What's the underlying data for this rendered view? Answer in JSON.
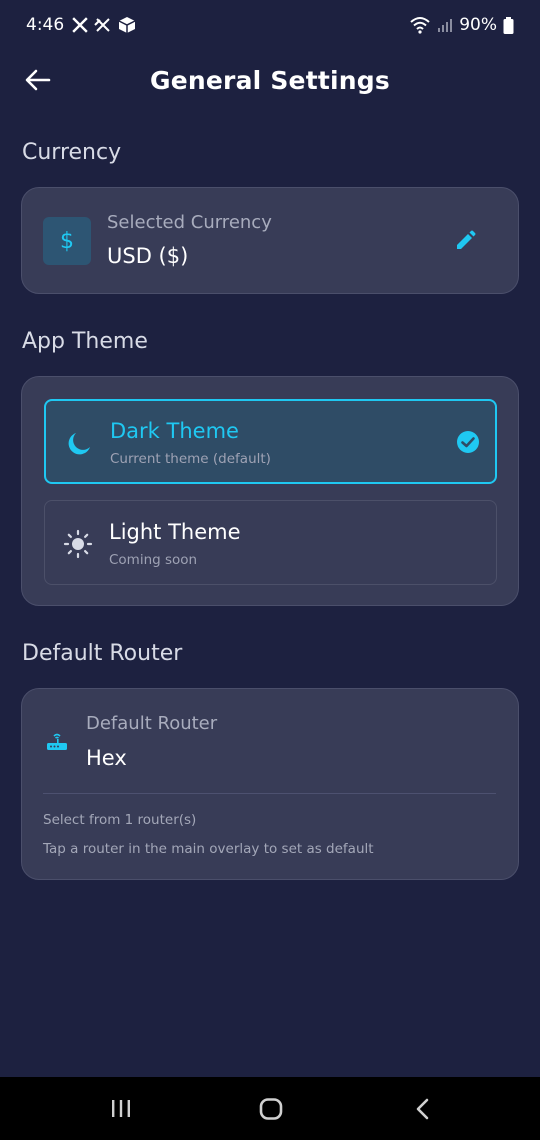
{
  "status_bar": {
    "time": "4:46",
    "battery": "90%",
    "notification_icons": [
      "x-icon",
      "x-crossed-icon",
      "box-app-icon"
    ]
  },
  "header": {
    "title": "General Settings",
    "back_icon": "arrow-left-icon"
  },
  "sections": {
    "currency_title": "Currency",
    "theme_title": "App Theme",
    "router_title": "Default Router"
  },
  "currency": {
    "icon_symbol": "$",
    "label": "Selected Currency",
    "value": "USD ($)",
    "edit_icon": "pencil-icon"
  },
  "themes": [
    {
      "name": "Dark Theme",
      "subtitle": "Current theme (default)",
      "icon": "moon-icon",
      "selected": true
    },
    {
      "name": "Light Theme",
      "subtitle": "Coming soon",
      "icon": "sun-icon",
      "selected": false
    }
  ],
  "router": {
    "icon": "router-icon",
    "label": "Default Router",
    "value": "Hex",
    "note_count": "Select from 1 router(s)",
    "note_hint": "Tap a router in the main overlay to set as default"
  },
  "colors": {
    "background": "#1d2140",
    "card": "#383c57",
    "accent": "#1fc8f2",
    "selected_option": "#2f4c66"
  }
}
